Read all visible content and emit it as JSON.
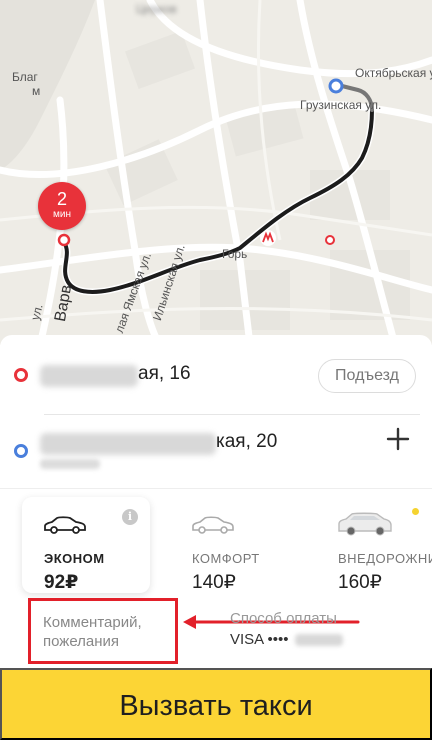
{
  "map": {
    "eta_value": "2",
    "eta_unit": "мин",
    "labels": {
      "oktyabrskaya": "Октябрьская ул.",
      "gruzinskaya": "Грузинская ул.",
      "blag": "Благ",
      "m": "м",
      "yamskaya": "лая Ямская ул.",
      "ilyinskaya": "Ильинская ул.",
      "gorky": "Горь",
      "varv": "Варв",
      "ul": "ул.",
      "tserkov": "Церков"
    },
    "colors": {
      "route": "#1c1c1c",
      "origin": "#e8323a",
      "destination": "#4a7fdc"
    }
  },
  "route": {
    "from_street_suffix": "ая, 16",
    "entrance_label": "Подъезд",
    "to_street_suffix": "кая, 20",
    "add_stop_label": "+"
  },
  "tariffs": [
    {
      "name": "ЭКОНОМ",
      "price": "92₽",
      "selected": true
    },
    {
      "name": "КОМФОРТ",
      "price": "140₽",
      "selected": false
    },
    {
      "name": "ВНЕДОРОЖНИ",
      "price": "160₽",
      "selected": false
    }
  ],
  "info_icon": "i",
  "comment": {
    "line1": "Комментарий,",
    "line2": "пожелания"
  },
  "payment": {
    "label": "Способ оплаты",
    "value": "VISA ••••"
  },
  "order_button": {
    "label": "Вызвать такси"
  },
  "theme": {
    "accent": "#fcd535",
    "highlight": "#e2202a"
  }
}
